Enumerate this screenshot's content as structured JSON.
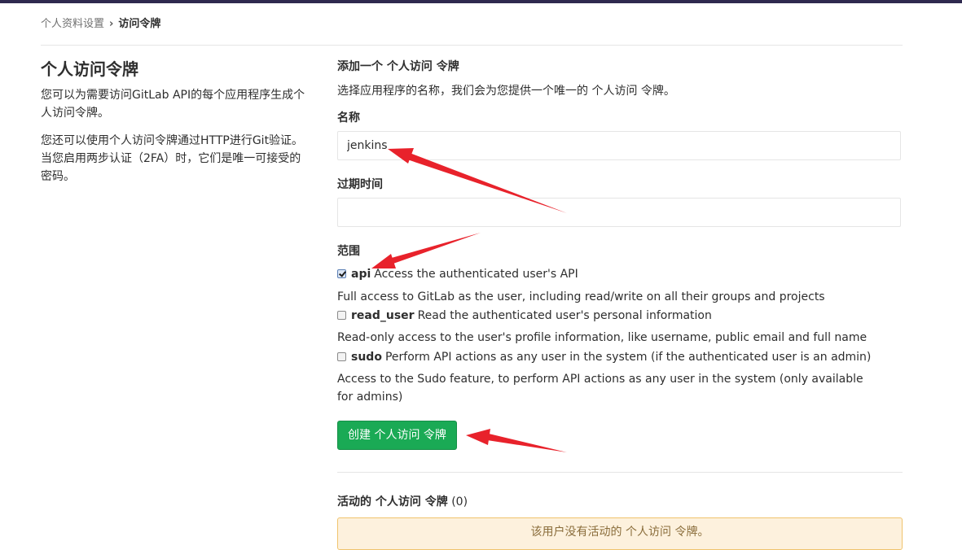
{
  "breadcrumb": {
    "parent": "个人资料设置",
    "separator": "›",
    "current": "访问令牌"
  },
  "sidebar": {
    "title": "个人访问令牌",
    "para1": "您可以为需要访问GitLab API的每个应用程序生成个人访问令牌。",
    "para2": "您还可以使用个人访问令牌通过HTTP进行Git验证。 当您启用两步认证（2FA）时，它们是唯一可接受的密码。"
  },
  "form": {
    "section_title": "添加一个 个人访问 令牌",
    "description": "选择应用程序的名称，我们会为您提供一个唯一的 个人访问 令牌。",
    "name_label": "名称",
    "name_value": "jenkins",
    "expires_label": "过期时间",
    "expires_value": "",
    "scopes_label": "范围",
    "scopes": [
      {
        "name": "api",
        "checked": true,
        "summary": "Access the authenticated user's API",
        "help": "Full access to GitLab as the user, including read/write on all their groups and projects"
      },
      {
        "name": "read_user",
        "checked": false,
        "summary": "Read the authenticated user's personal information",
        "help": "Read-only access to the user's profile information, like username, public email and full name"
      },
      {
        "name": "sudo",
        "checked": false,
        "summary": "Perform API actions as any user in the system (if the authenticated user is an admin)",
        "help": "Access to the Sudo feature, to perform API actions as any user in the system (only available for admins)"
      }
    ],
    "submit_label": "创建 个人访问 令牌"
  },
  "active_tokens": {
    "title": "活动的 个人访问 令牌",
    "count": "(0)",
    "empty_message": "该用户没有活动的 个人访问 令牌。"
  },
  "colors": {
    "accent_green": "#1aaa55",
    "annotation_red": "#e8222b",
    "topbar": "#2f2a4f"
  }
}
